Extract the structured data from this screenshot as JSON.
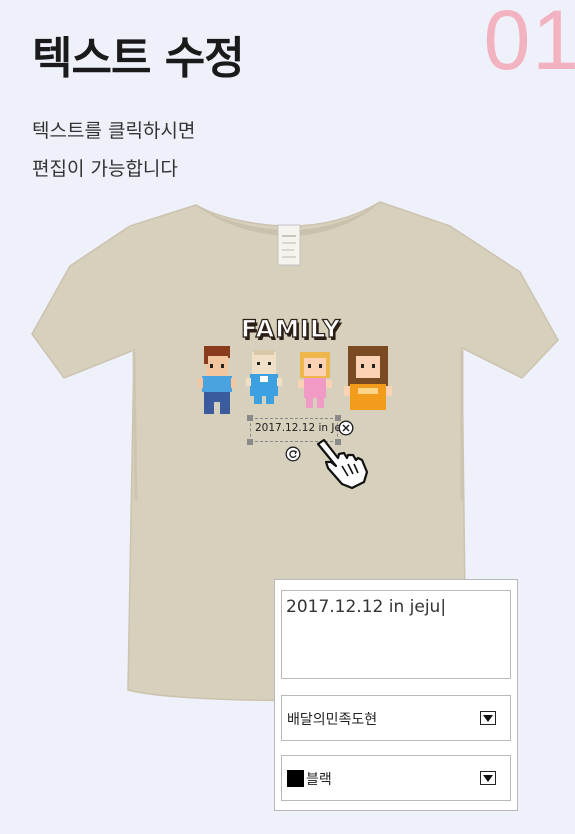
{
  "step_number": "01",
  "title": "텍스트 수정",
  "description": {
    "line1": "텍스트를 클릭하시면",
    "line2": "편집이 가능합니다"
  },
  "design": {
    "logo_text": "FAMILY",
    "selected_text": "2017.12.12 in Jeju"
  },
  "editor": {
    "text_value": "2017.12.12 in jeju|",
    "font_value": "배달의민족도현",
    "color_label": "블랙",
    "color_hex": "#000000"
  },
  "colors": {
    "shirt": "#d7d0bd",
    "step_number": "#f3b2c0",
    "background": "#eef0fa"
  }
}
